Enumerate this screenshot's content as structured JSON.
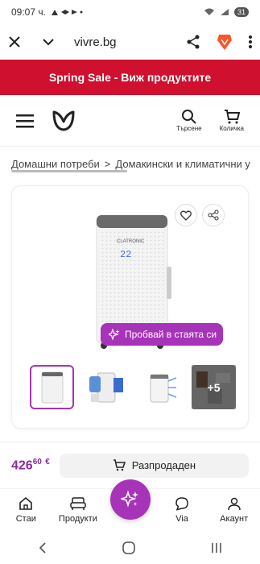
{
  "status": {
    "time": "09:07 ч.",
    "battery": "31"
  },
  "browser": {
    "url": "vivre.bg"
  },
  "banner": {
    "text": "Spring Sale - Виж продуктите"
  },
  "header": {
    "search_label": "Търсене",
    "cart_label": "Количка"
  },
  "breadcrumb": {
    "items": [
      "Домашни потреби",
      "Домакински и климатични у"
    ]
  },
  "product": {
    "try_label": "Пробвай в стаята си",
    "display_value": "22",
    "more_images": "+5"
  },
  "price": {
    "main": "426",
    "cents": "60",
    "currency": "€"
  },
  "soldout_label": "Разпродаден",
  "nav": {
    "rooms": "Стаи",
    "products": "Продукти",
    "via": "Via",
    "account": "Акаунт"
  },
  "colors": {
    "brand": "#a733b8",
    "banner": "#d0102f",
    "price": "#8a2aa0"
  }
}
